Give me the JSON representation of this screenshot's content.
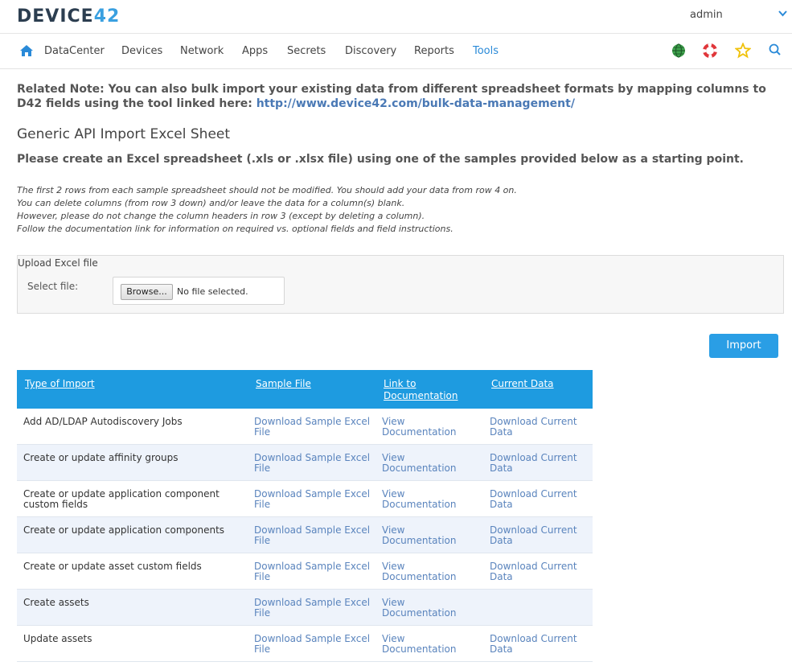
{
  "brand": {
    "logo_main": "DEVICE",
    "logo_num": "42"
  },
  "user": {
    "name": "admin"
  },
  "nav": {
    "items": [
      {
        "label": "DataCenter"
      },
      {
        "label": "Devices"
      },
      {
        "label": "Network"
      },
      {
        "label": "Apps"
      },
      {
        "label": "Secrets"
      },
      {
        "label": "Discovery"
      },
      {
        "label": "Reports"
      },
      {
        "label": "Tools"
      }
    ],
    "active": "Tools"
  },
  "related": {
    "text": "Related Note: You can also bulk import your existing data from different spreadsheet formats by mapping columns to D42 fields using the tool linked here:",
    "link": "http://www.device42.com/bulk-data-management/"
  },
  "heading": "Generic API Import Excel Sheet",
  "instruction": "Please create an Excel spreadsheet (.xls or .xlsx file) using one of the samples provided below as a starting point.",
  "notes": [
    "The first 2 rows from each sample spreadsheet should not be modified. You should add your data from row 4 on.",
    "You can delete columns (from row 3 down) and/or leave the data for a column(s) blank.",
    "However, please do not change the column headers in row 3 (except by deleting a column).",
    "Follow the documentation link for information on required vs. optional fields and field instructions."
  ],
  "upload": {
    "title": "Upload Excel file",
    "select_label": "Select file:",
    "browse_label": "Browse...",
    "file_status": "No file selected."
  },
  "import_label": "Import",
  "table": {
    "headers": [
      "Type of Import",
      "Sample File",
      "Link to Documentation",
      "Current Data"
    ],
    "rows": [
      {
        "type": "Add AD/LDAP Autodiscovery Jobs",
        "sample": "Download Sample Excel File",
        "doc": "View Documentation",
        "current": "Download Current Data"
      },
      {
        "type": "Create or update affinity groups",
        "sample": "Download Sample Excel File",
        "doc": "View Documentation",
        "current": "Download Current Data"
      },
      {
        "type": "Create or update application component custom fields",
        "sample": "Download Sample Excel File",
        "doc": "View Documentation",
        "current": "Download Current Data"
      },
      {
        "type": "Create or update application components",
        "sample": "Download Sample Excel File",
        "doc": "View Documentation",
        "current": "Download Current Data"
      },
      {
        "type": "Create or update asset custom fields",
        "sample": "Download Sample Excel File",
        "doc": "View Documentation",
        "current": "Download Current Data"
      },
      {
        "type": "Create assets",
        "sample": "Download Sample Excel File",
        "doc": "View Documentation",
        "current": ""
      },
      {
        "type": "Update assets",
        "sample": "Download Sample Excel File",
        "doc": "View Documentation",
        "current": "Download Current Data"
      }
    ]
  },
  "colors": {
    "accent": "#1e9be0",
    "link": "#5a84bd",
    "header_bg": "#1e9be0",
    "row_alt": "#eef3fb"
  },
  "icons": {
    "home": "home-icon",
    "globe": "globe-icon",
    "help": "lifebuoy-icon",
    "favorite": "star-icon",
    "search": "search-icon",
    "user_menu": "chevron-down-icon"
  }
}
